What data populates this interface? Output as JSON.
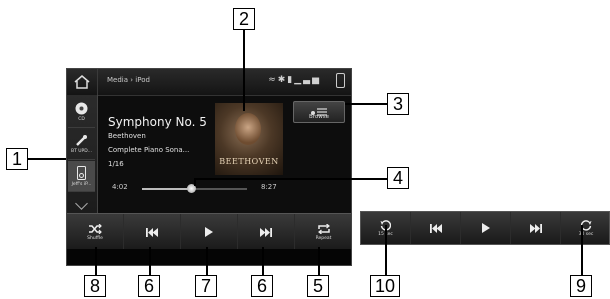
{
  "header": {
    "breadcrumb": "Media › iPod",
    "status_icons": [
      "wifi-icon",
      "bluetooth-icon",
      "roaming-icon",
      "signal-icon"
    ],
    "phone_icon": "phone-icon"
  },
  "sources": {
    "items": [
      {
        "label": "CD",
        "icon": "cd-icon"
      },
      {
        "label": "BT UPD...",
        "icon": "bluetooth-audio-icon"
      },
      {
        "label": "Jeff's iP...",
        "icon": "ipod-icon"
      }
    ],
    "more_icon": "chevron-down-icon"
  },
  "now_playing": {
    "title": "Symphony No. 5",
    "artist": "Beethoven",
    "album": "Complete Piano Sona...",
    "track_count": "1/16",
    "album_art_text": "BEETHOVEN"
  },
  "browse": {
    "label": "Browse",
    "icon": "browse-list-icon"
  },
  "progress": {
    "elapsed": "4:02",
    "total": "8:27",
    "fraction": 0.47
  },
  "controls": [
    {
      "label": "Shuffle",
      "icon": "shuffle-icon"
    },
    {
      "label": "",
      "icon": "previous-track-icon"
    },
    {
      "label": "",
      "icon": "play-icon"
    },
    {
      "label": "",
      "icon": "next-track-icon"
    },
    {
      "label": "Repeat",
      "icon": "repeat-icon"
    }
  ],
  "alt_controls": [
    {
      "label": "15 sec",
      "icon": "skip-back-15-icon"
    },
    {
      "label": "",
      "icon": "previous-track-icon"
    },
    {
      "label": "",
      "icon": "play-icon"
    },
    {
      "label": "",
      "icon": "next-track-icon"
    },
    {
      "label": "30 sec",
      "icon": "skip-forward-30-icon"
    }
  ],
  "callouts": [
    "1",
    "2",
    "3",
    "4",
    "5",
    "6",
    "7",
    "6",
    "8",
    "9",
    "10"
  ]
}
